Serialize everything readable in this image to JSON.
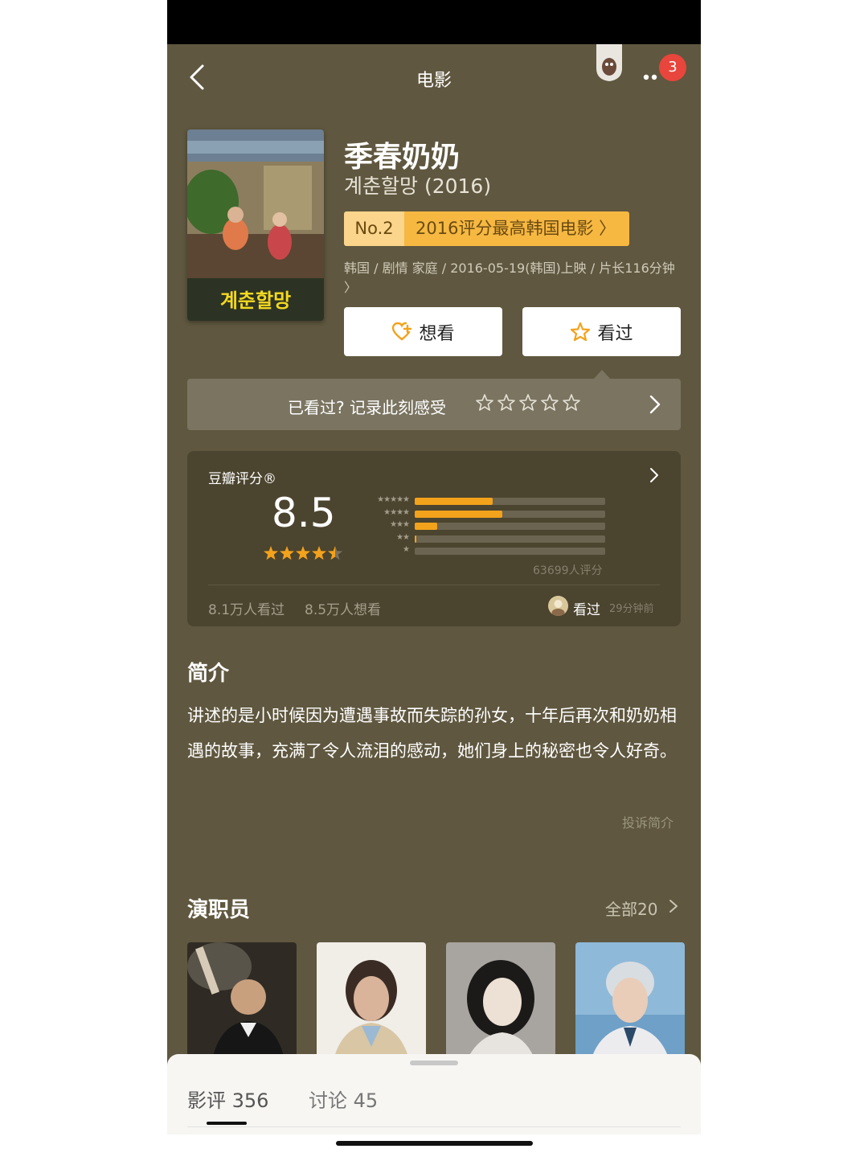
{
  "nav": {
    "title": "电影",
    "badge_count": "3"
  },
  "movie": {
    "poster_text": "계춘할망",
    "title": "季春奶奶",
    "original_title": "계춘할망 (2016)",
    "rank_no": "No.2",
    "rank_text": "2016评分最高韩国电影 〉",
    "meta": "韩国 / 剧情 家庭 / 2016-05-19(韩国)上映 / 片长116分钟 〉"
  },
  "actions": {
    "want_label": "想看",
    "seen_label": "看过"
  },
  "record": {
    "prompt": "已看过? 记录此刻感受",
    "star_count": 5
  },
  "rating": {
    "label": "豆瓣评分®",
    "score": "8.5",
    "stars": 4.5,
    "distribution": [
      {
        "stars": "★★★★★",
        "fraction": 0.41
      },
      {
        "stars": "★★★★",
        "fraction": 0.46
      },
      {
        "stars": "★★★",
        "fraction": 0.12
      },
      {
        "stars": "★★",
        "fraction": 0.01
      },
      {
        "stars": "★",
        "fraction": 0.0
      }
    ],
    "count": "63699人评分",
    "watched": "8.1万人看过",
    "wish": "8.5万人想看",
    "friend_action": "看过",
    "friend_time": "29分钟前"
  },
  "intro": {
    "heading": "简介",
    "text": "讲述的是小时候因为遭遇事故而失踪的孙女，十年后再次和奶奶相遇的故事，充满了令人流泪的感动，她们身上的秘密也令人好奇。",
    "report": "投诉简介"
  },
  "cast": {
    "heading": "演职员",
    "all_label": "全部20"
  },
  "sheet": {
    "reviews_tab": "影评 356",
    "discuss_tab": "讨论 45"
  },
  "colors": {
    "page_bg": "#5f573f",
    "accent_orange": "#f3a21b",
    "rank_gold": "#f6b841"
  }
}
